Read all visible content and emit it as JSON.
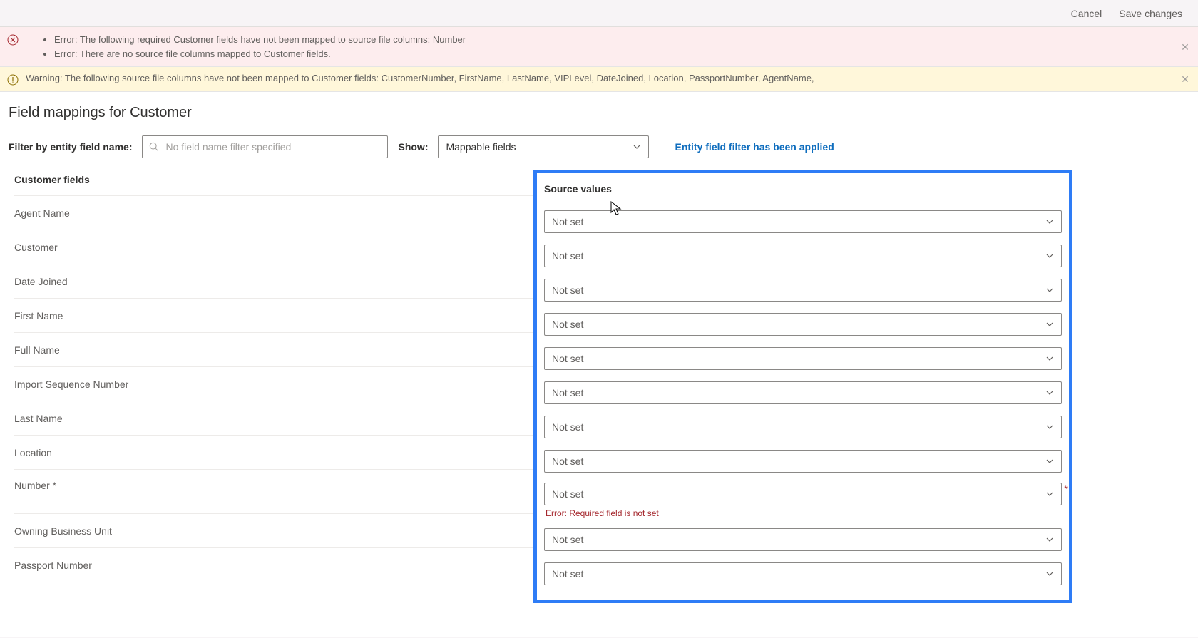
{
  "topbar": {
    "cancel": "Cancel",
    "save": "Save changes"
  },
  "alerts": {
    "error1": "Error: The following required Customer fields have not been mapped to source file columns: Number",
    "error2": "Error: There are no source file columns mapped to Customer fields.",
    "warning": "Warning: The following source file columns have not been mapped to Customer fields: CustomerNumber, FirstName, LastName, VIPLevel, DateJoined, Location, PassportNumber, AgentName,"
  },
  "page": {
    "title": "Field mappings for Customer"
  },
  "filter": {
    "label": "Filter by entity field name:",
    "placeholder": "No field name filter specified",
    "show_label": "Show:",
    "show_value": "Mappable fields",
    "applied": "Entity field filter has been applied"
  },
  "columns": {
    "left": "Customer fields",
    "right": "Source values"
  },
  "fields": [
    {
      "label": "Agent Name",
      "value": "Not set",
      "error": ""
    },
    {
      "label": "Customer",
      "value": "Not set",
      "error": ""
    },
    {
      "label": "Date Joined",
      "value": "Not set",
      "error": ""
    },
    {
      "label": "First Name",
      "value": "Not set",
      "error": ""
    },
    {
      "label": "Full Name",
      "value": "Not set",
      "error": ""
    },
    {
      "label": "Import Sequence Number",
      "value": "Not set",
      "error": ""
    },
    {
      "label": "Last Name",
      "value": "Not set",
      "error": ""
    },
    {
      "label": "Location",
      "value": "Not set",
      "error": ""
    },
    {
      "label": "Number *",
      "value": "Not set",
      "error": "Error: Required field is not set"
    },
    {
      "label": "Owning Business Unit",
      "value": "Not set",
      "error": ""
    },
    {
      "label": "Passport Number",
      "value": "Not set",
      "error": ""
    }
  ]
}
